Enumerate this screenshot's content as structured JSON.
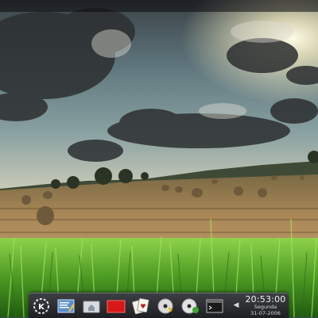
{
  "taskbar": {
    "icons": [
      {
        "name": "kde-menu-icon"
      },
      {
        "name": "text-editor-icon"
      },
      {
        "name": "home-folder-icon"
      },
      {
        "name": "red-app-icon"
      },
      {
        "name": "cards-game-icon"
      },
      {
        "name": "cd-audio-icon"
      },
      {
        "name": "cd-burn-icon"
      },
      {
        "name": "terminal-icon"
      }
    ],
    "tray_arrow": "◀",
    "clock": {
      "time": "20:53:00",
      "day": "Segunda",
      "date": "31-07-2006"
    }
  },
  "colors": {
    "taskbar": "#2a2b2f",
    "sky": "#6f8a92",
    "field": "#b08a4e",
    "grass": "#4f9a2b"
  }
}
